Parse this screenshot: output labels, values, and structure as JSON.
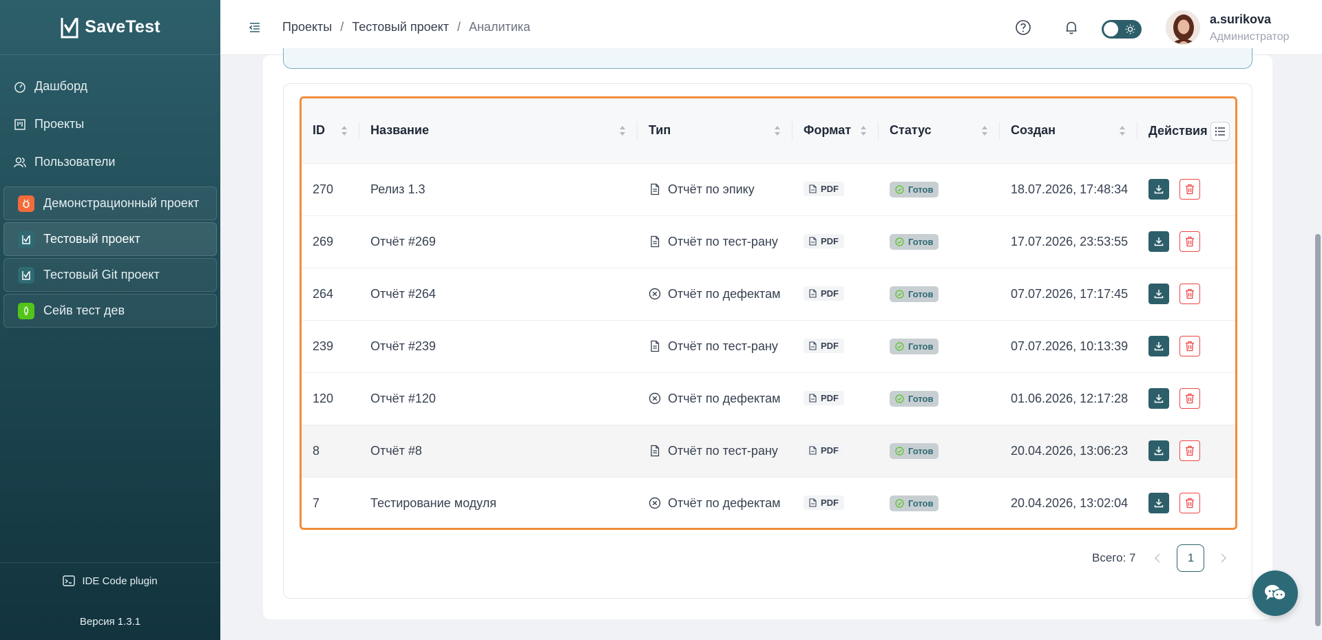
{
  "app": {
    "name": "SaveTest",
    "version": "Версия 1.3.1",
    "plugin": "IDE Code plugin"
  },
  "sidebar": {
    "nav": [
      {
        "label": "Дашборд",
        "icon": "dashboard-icon"
      },
      {
        "label": "Проекты",
        "icon": "projects-icon"
      },
      {
        "label": "Пользователи",
        "icon": "users-icon"
      }
    ],
    "projects": [
      {
        "label": "Демонстрационный проект",
        "color": "#f26b3a",
        "icon": "bug-icon"
      },
      {
        "label": "Тестовый проект",
        "color": "#2f6a73",
        "icon": "savetest-icon",
        "active": true
      },
      {
        "label": "Тестовый Git проект",
        "color": "#2f6a73",
        "icon": "savetest-icon"
      },
      {
        "label": "Сейв тест дев",
        "color": "#52c41a",
        "icon": "rocket-icon"
      }
    ]
  },
  "header": {
    "breadcrumb": [
      "Проекты",
      "Тестовый проект",
      "Аналитика"
    ],
    "separator": "/",
    "user": {
      "name": "a.surikova",
      "role": "Администратор"
    }
  },
  "table": {
    "columns": [
      "ID",
      "Название",
      "Тип",
      "Формат",
      "Статус",
      "Создан",
      "Действия"
    ],
    "rows": [
      {
        "id": "270",
        "name": "Релиз 1.3",
        "type": "Отчёт по эпику",
        "type_icon": "document-icon",
        "format": "PDF",
        "status": "Готов",
        "created": "18.07.2026, 17:48:34"
      },
      {
        "id": "269",
        "name": "Отчёт #269",
        "type": "Отчёт по тест-рану",
        "type_icon": "document-icon",
        "format": "PDF",
        "status": "Готов",
        "created": "17.07.2026, 23:53:55"
      },
      {
        "id": "264",
        "name": "Отчёт #264",
        "type": "Отчёт по дефектам",
        "type_icon": "circle-x-icon",
        "format": "PDF",
        "status": "Готов",
        "created": "07.07.2026, 17:17:45"
      },
      {
        "id": "239",
        "name": "Отчёт #239",
        "type": "Отчёт по тест-рану",
        "type_icon": "document-icon",
        "format": "PDF",
        "status": "Готов",
        "created": "07.07.2026, 10:13:39"
      },
      {
        "id": "120",
        "name": "Отчёт #120",
        "type": "Отчёт по дефектам",
        "type_icon": "circle-x-icon",
        "format": "PDF",
        "status": "Готов",
        "created": "01.06.2026, 12:17:28"
      },
      {
        "id": "8",
        "name": "Отчёт #8",
        "type": "Отчёт по тест-рану",
        "type_icon": "document-icon",
        "format": "PDF",
        "status": "Готов",
        "created": "20.04.2026, 13:06:23",
        "hovered": true
      },
      {
        "id": "7",
        "name": "Тестирование модуля",
        "type": "Отчёт по дефектам",
        "type_icon": "circle-x-icon",
        "format": "PDF",
        "status": "Готов",
        "created": "20.04.2026, 13:02:04"
      }
    ]
  },
  "pagination": {
    "total": "Всего: 7",
    "current_page": "1"
  },
  "colors": {
    "brand": "#2d5f6a",
    "highlight": "#f28c38",
    "danger": "#ef4444",
    "status_ok": "#52c41a"
  }
}
